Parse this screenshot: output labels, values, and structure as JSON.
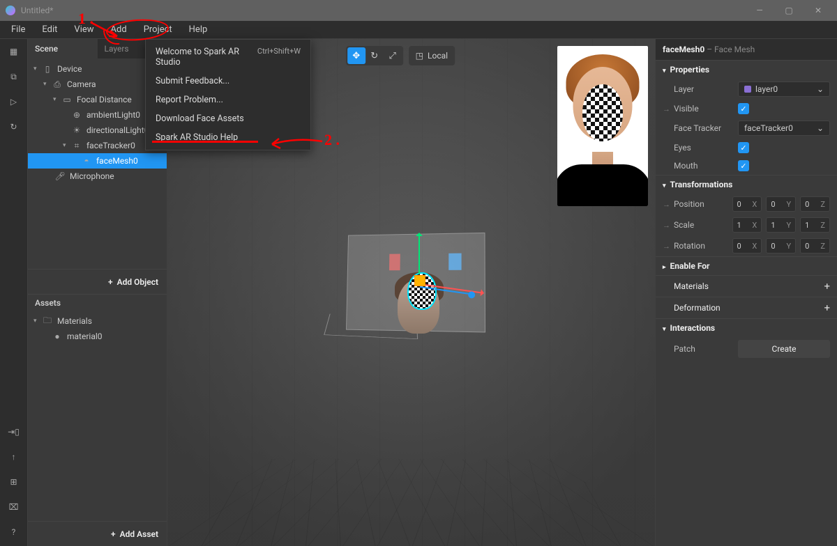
{
  "window": {
    "title": "Untitled*"
  },
  "menubar": [
    "File",
    "Edit",
    "View",
    "Add",
    "Project",
    "Help"
  ],
  "leftrail": {
    "top": [
      "viewport-icon",
      "camera-icon",
      "play-icon",
      "refresh-icon"
    ],
    "bottom": [
      "mobile-icon",
      "upload-icon",
      "library-icon",
      "bug-icon",
      "help-icon"
    ]
  },
  "scene": {
    "tabs": [
      "Scene",
      "Layers"
    ],
    "active_tab": 0,
    "tree": [
      {
        "name": "Device",
        "icon": "device",
        "indent": 0,
        "collapsible": true
      },
      {
        "name": "Camera",
        "icon": "camera",
        "indent": 1,
        "collapsible": true
      },
      {
        "name": "Focal Distance",
        "icon": "focal",
        "indent": 2,
        "collapsible": true
      },
      {
        "name": "ambientLight0",
        "icon": "globe",
        "indent": 3
      },
      {
        "name": "directionalLight0",
        "icon": "dirlight",
        "indent": 3
      },
      {
        "name": "faceTracker0",
        "icon": "facetracker",
        "indent": 3,
        "collapsible": true
      },
      {
        "name": "faceMesh0",
        "icon": "shield",
        "indent": 4,
        "selected": true
      },
      {
        "name": "Microphone",
        "icon": "mic",
        "indent": 1
      }
    ],
    "add_label": "Add Object"
  },
  "assets": {
    "title": "Assets",
    "tree": [
      {
        "name": "Materials",
        "icon": "folder",
        "indent": 0,
        "collapsible": true
      },
      {
        "name": "material0",
        "icon": "sphere",
        "indent": 1
      }
    ],
    "add_label": "Add Asset"
  },
  "viewport": {
    "tool_buttons": [
      "move-icon",
      "rotate-icon",
      "scale-icon"
    ],
    "active_tool": 0,
    "space_button": "Local"
  },
  "help_menu": [
    {
      "label": "Welcome to Spark AR Studio",
      "shortcut": "Ctrl+Shift+W"
    },
    {
      "label": "Submit Feedback..."
    },
    {
      "label": "Report Problem..."
    },
    {
      "label": "Download Face Assets"
    },
    {
      "label": "Spark AR Studio Help"
    }
  ],
  "inspector": {
    "title_main": "faceMesh0",
    "title_type": " – Face Mesh",
    "sections": {
      "properties": "Properties",
      "transformations": "Transformations",
      "enablefor": "Enable For",
      "materials": "Materials",
      "deformation": "Deformation",
      "interactions": "Interactions"
    },
    "rows": {
      "layer": {
        "label": "Layer",
        "value": "layer0"
      },
      "visible": {
        "label": "Visible",
        "checked": true
      },
      "facetracker": {
        "label": "Face Tracker",
        "value": "faceTracker0"
      },
      "eyes": {
        "label": "Eyes",
        "checked": true
      },
      "mouth": {
        "label": "Mouth",
        "checked": true
      },
      "position": {
        "label": "Position",
        "x": "0",
        "y": "0",
        "z": "0"
      },
      "scale": {
        "label": "Scale",
        "x": "1",
        "y": "1",
        "z": "1"
      },
      "rotation": {
        "label": "Rotation",
        "x": "0",
        "y": "0",
        "z": "0"
      },
      "patch": {
        "label": "Patch",
        "button": "Create"
      }
    }
  },
  "annotations": {
    "one": "1 .",
    "two": "2 ."
  }
}
